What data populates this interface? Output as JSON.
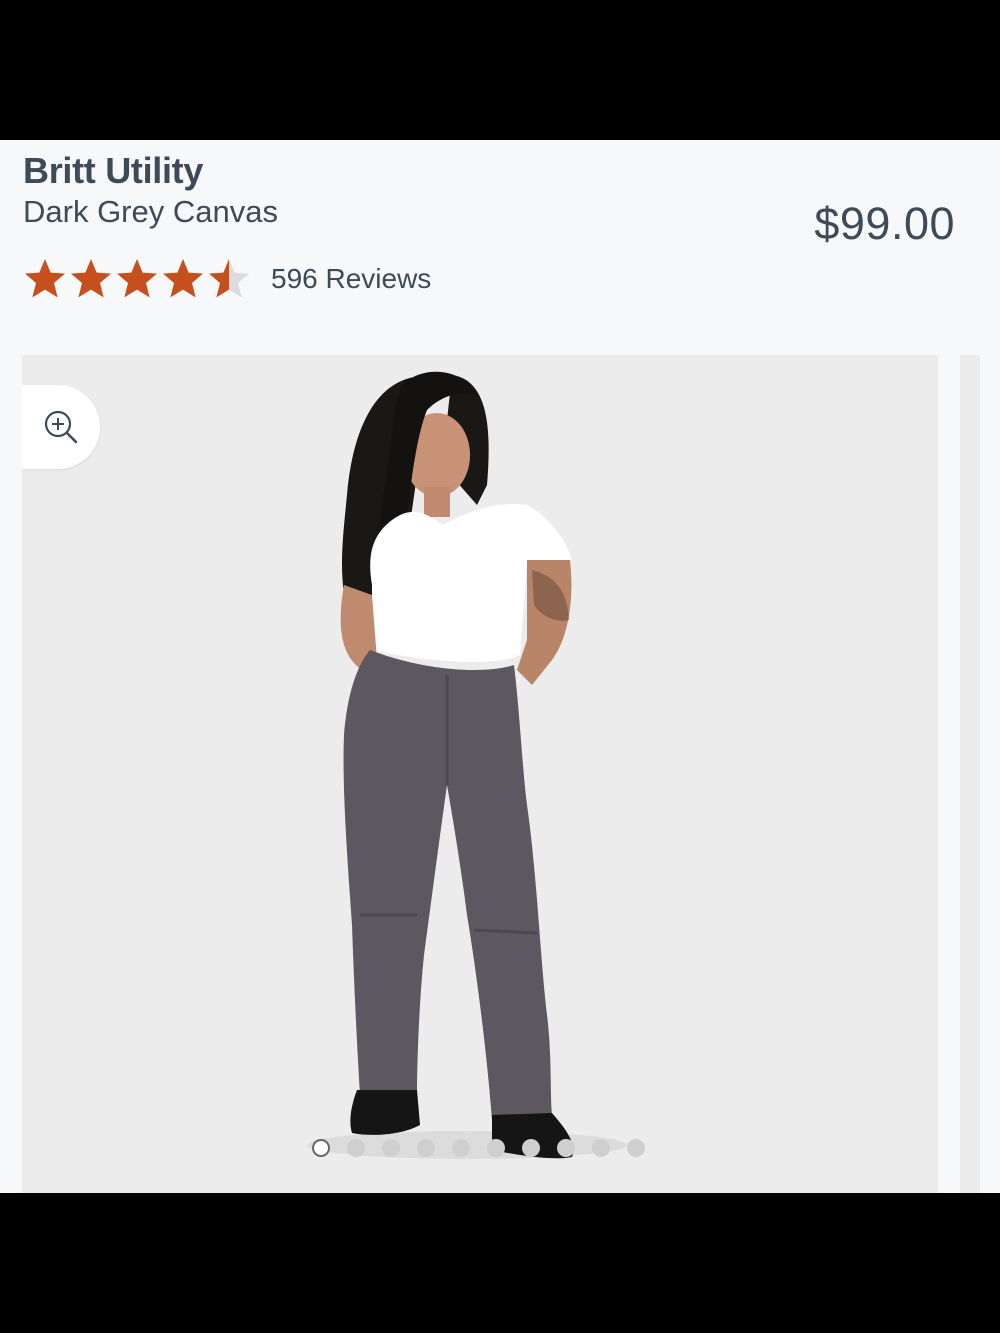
{
  "product": {
    "title": "Britt Utility",
    "variant": "Dark Grey Canvas",
    "price": "$99.00"
  },
  "rating": {
    "value": 4.5,
    "max": 5,
    "reviews_label": "596 Reviews",
    "star_color": "#c5501e",
    "empty_star_color": "#dcdcdc"
  },
  "gallery": {
    "zoom_icon": "zoom-in-icon",
    "image_alt": "model-wearing-dark-grey-canvas-pants",
    "slide_count": 10,
    "active_slide": 1
  },
  "colors": {
    "text": "#3d4a57",
    "background": "#f7f8f9",
    "gallery_bg": "#ececec"
  }
}
